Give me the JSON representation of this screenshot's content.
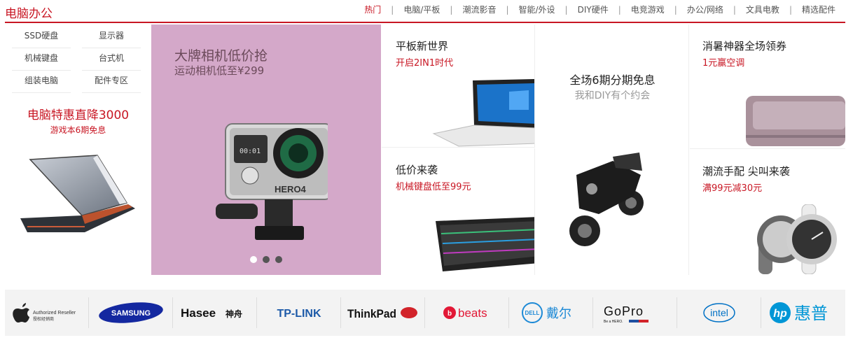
{
  "header": {
    "title": "电脑办公",
    "nav": [
      {
        "label": "热门",
        "active": true
      },
      {
        "label": "电脑/平板"
      },
      {
        "label": "潮流影音"
      },
      {
        "label": "智能/外设"
      },
      {
        "label": "DIY硬件"
      },
      {
        "label": "电竞游戏"
      },
      {
        "label": "办公/网络"
      },
      {
        "label": "文具电教"
      },
      {
        "label": "精选配件"
      }
    ],
    "separator": "|"
  },
  "sidebar": {
    "links": [
      "SSD硬盘",
      "显示器",
      "机械键盘",
      "台式机",
      "组装电脑",
      "配件专区"
    ],
    "promo_title": "电脑特惠直降3000",
    "promo_sub": "游戏本6期免息"
  },
  "banner": {
    "title": "大牌相机低价抢",
    "subtitle": "运动相机低至¥299",
    "camera_label": "HERO4",
    "slides": 3,
    "active_slide": 0
  },
  "cells": {
    "tablet": {
      "title": "平板新世界",
      "sub": "开启2IN1时代"
    },
    "keyboard": {
      "title": "低价来袭",
      "sub": "机械键盘低至99元"
    },
    "installment": {
      "title": "全场6期分期免息",
      "sub": "我和DIY有个约会"
    },
    "aircon": {
      "title": "消暑神器全场领券",
      "sub": "1元赢空调"
    },
    "watch": {
      "title": "潮流手配 尖叫来袭",
      "sub": "满99元减30元"
    }
  },
  "brands": [
    {
      "name": "apple",
      "text": "Authorized Reseller",
      "text2": "授权经销商"
    },
    {
      "name": "samsung",
      "text": "SAMSUNG"
    },
    {
      "name": "hasee",
      "text": "Hasee",
      "text2": "神舟"
    },
    {
      "name": "tplink",
      "text": "TP-LINK"
    },
    {
      "name": "thinkpad",
      "text": "ThinkPad"
    },
    {
      "name": "beats",
      "text": "beats",
      "text2": "b"
    },
    {
      "name": "dell",
      "text": "DELL",
      "text2": "戴尔"
    },
    {
      "name": "gopro",
      "text": "GoPro",
      "text2": "Be a HERO."
    },
    {
      "name": "intel",
      "text": "intel"
    },
    {
      "name": "hp",
      "text": "hp",
      "text2": "惠普"
    }
  ],
  "colors": {
    "accent": "#c81623",
    "banner_bg": "#d4a8c9"
  }
}
